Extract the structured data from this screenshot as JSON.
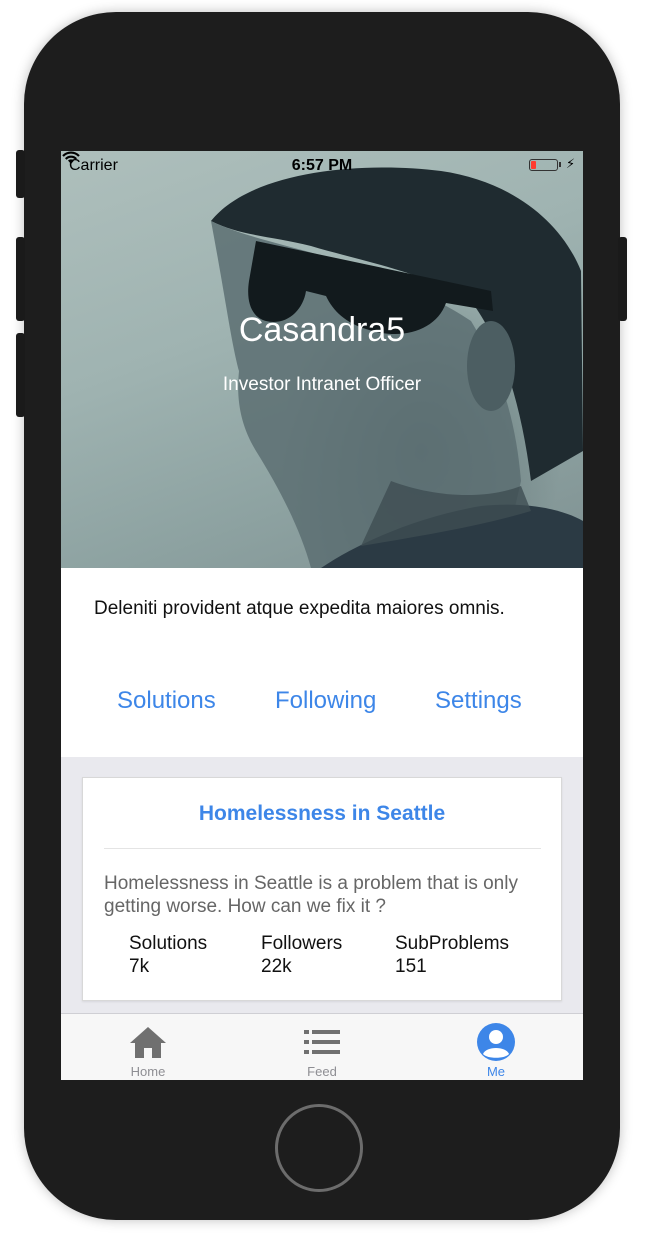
{
  "status_bar": {
    "carrier": "Carrier",
    "time": "6:57 PM",
    "battery_level": 0.2,
    "battery_color": "#ff3b30"
  },
  "profile": {
    "name": "Casandra5",
    "title": "Investor Intranet Officer",
    "bio": "Deleniti provident atque expedita maiores omnis."
  },
  "profile_tabs": [
    {
      "label": "Solutions"
    },
    {
      "label": "Following"
    },
    {
      "label": "Settings"
    }
  ],
  "problem_card": {
    "title": "Homelessness in Seattle",
    "description": "Homelessness in Seattle is a problem that is only getting worse. How can we fix it ?",
    "stats": [
      {
        "label": "Solutions",
        "value": "7k"
      },
      {
        "label": "Followers",
        "value": "22k"
      },
      {
        "label": "SubProblems",
        "value": "151"
      }
    ]
  },
  "tab_bar": {
    "items": [
      {
        "label": "Home",
        "icon": "home-icon",
        "active": false
      },
      {
        "label": "Feed",
        "icon": "list-icon",
        "active": false
      },
      {
        "label": "Me",
        "icon": "user-circle-icon",
        "active": true
      }
    ],
    "active_color": "#3d86e8",
    "inactive_color": "#8e8e93"
  },
  "colors": {
    "accent": "#3d86e8",
    "device_frame": "#1d1d1d",
    "feed_background": "#e9e9ee"
  }
}
